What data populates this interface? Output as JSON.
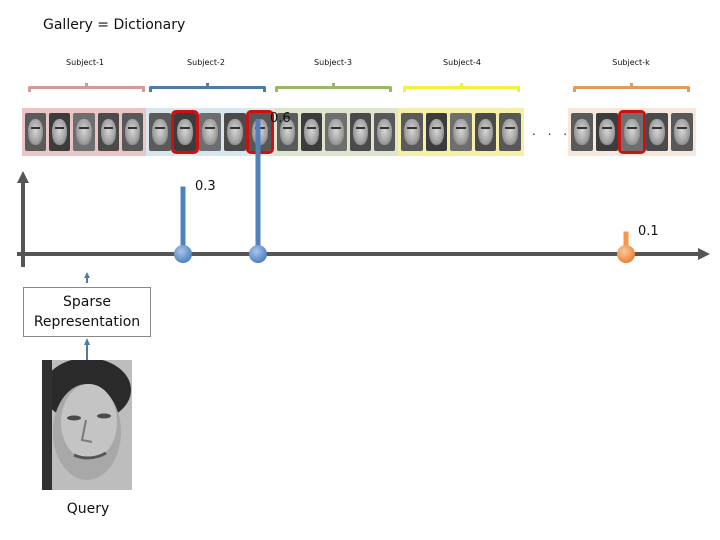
{
  "title": "Gallery = Dictionary",
  "subjects": [
    {
      "label": "Subject-1",
      "color": "#d49a9a",
      "bg": "#e9c5c5",
      "faces": 5,
      "selected": []
    },
    {
      "label": "Subject-2",
      "color": "#4f7ba8",
      "bg": "#d8e6ee",
      "faces": 5,
      "selected": [
        1,
        4
      ]
    },
    {
      "label": "Subject-3",
      "color": "#9cb763",
      "bg": "#dde5cf",
      "faces": 5,
      "selected": []
    },
    {
      "label": "Subject-4",
      "color": "#f2f23a",
      "bg": "#f6efa8",
      "faces": 5,
      "selected": []
    },
    {
      "label": "Subject-k",
      "color": "#e39a5c",
      "bg": "#f7e8de",
      "faces": 5,
      "selected": [
        2
      ]
    }
  ],
  "ellipsis": ". . .",
  "coefficients": [
    {
      "label": "0.3",
      "value": 0.3,
      "color": "#4f81bd"
    },
    {
      "label": "0.6",
      "value": 0.6,
      "color": "#4f81bd"
    },
    {
      "label": "0.1",
      "value": 0.1,
      "color": "#f79646"
    }
  ],
  "box_label_line1": "Sparse",
  "box_label_line2": "Representation",
  "query_label": "Query",
  "colors": {
    "axis": "#555555",
    "arrow": "#4f7ba8",
    "selection": "#cc1111"
  }
}
